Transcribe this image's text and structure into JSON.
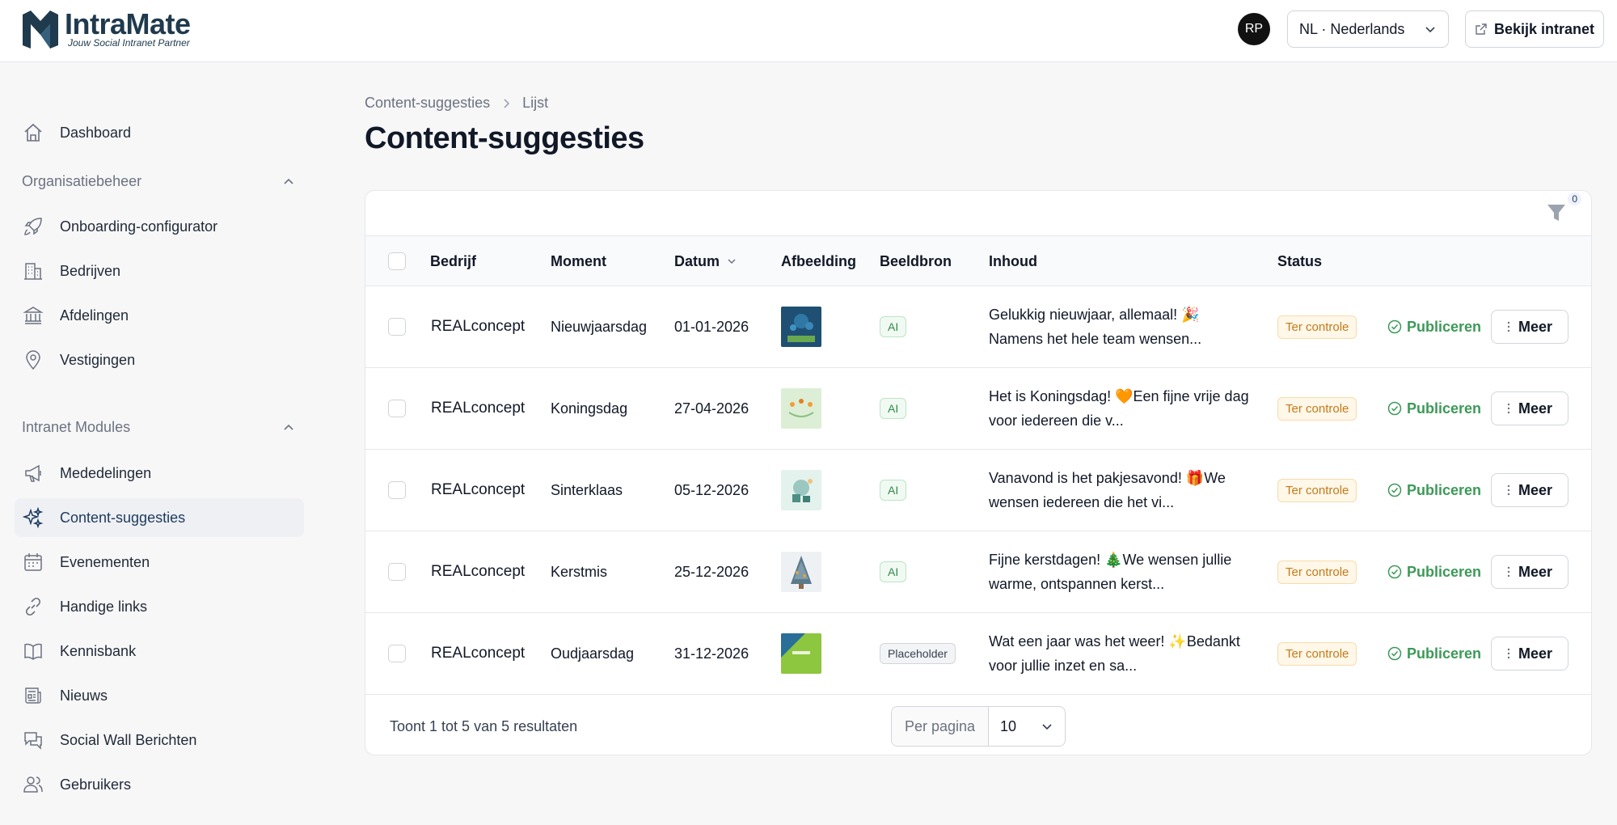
{
  "header": {
    "brand_name": "IntraMate",
    "brand_tagline": "Jouw Social Intranet Partner",
    "avatar_initials": "RP",
    "language": "NL · Nederlands",
    "view_intranet": "Bekijk intranet"
  },
  "sidebar": {
    "dashboard": "Dashboard",
    "group_org": "Organisatiebeheer",
    "org_items": [
      "Onboarding-configurator",
      "Bedrijven",
      "Afdelingen",
      "Vestigingen"
    ],
    "group_modules": "Intranet Modules",
    "module_items": [
      "Mededelingen",
      "Content-suggesties",
      "Evenementen",
      "Handige links",
      "Kennisbank",
      "Nieuws",
      "Social Wall Berichten",
      "Gebruikers"
    ],
    "active_item": "Content-suggesties"
  },
  "breadcrumb": {
    "parent": "Content-suggesties",
    "current": "Lijst"
  },
  "page": {
    "title": "Content-suggesties"
  },
  "filter": {
    "count": "0"
  },
  "table": {
    "columns": {
      "company": "Bedrijf",
      "moment": "Moment",
      "date": "Datum",
      "image": "Afbeelding",
      "source": "Beeldbron",
      "content": "Inhoud",
      "status": "Status"
    },
    "rows": [
      {
        "company": "REALconcept",
        "moment": "Nieuwjaarsdag",
        "date": "01-01-2026",
        "source": "AI",
        "content": "Gelukkig nieuwjaar, allemaal! 🎉 Namens het hele team wensen...",
        "status": "Ter controle",
        "publish": "Publiceren",
        "more": "Meer"
      },
      {
        "company": "REALconcept",
        "moment": "Koningsdag",
        "date": "27-04-2026",
        "source": "AI",
        "content": "Het is Koningsdag! 🧡Een fijne vrije dag voor iedereen die v...",
        "status": "Ter controle",
        "publish": "Publiceren",
        "more": "Meer"
      },
      {
        "company": "REALconcept",
        "moment": "Sinterklaas",
        "date": "05-12-2026",
        "source": "AI",
        "content": "Vanavond is het pakjesavond! 🎁We wensen iedereen die het vi...",
        "status": "Ter controle",
        "publish": "Publiceren",
        "more": "Meer"
      },
      {
        "company": "REALconcept",
        "moment": "Kerstmis",
        "date": "25-12-2026",
        "source": "AI",
        "content": "Fijne kerstdagen! 🎄We wensen jullie warme, ontspannen kerst...",
        "status": "Ter controle",
        "publish": "Publiceren",
        "more": "Meer"
      },
      {
        "company": "REALconcept",
        "moment": "Oudjaarsdag",
        "date": "31-12-2026",
        "source": "Placeholder",
        "content": "Wat een jaar was het weer! ✨Bedankt voor jullie inzet en sa...",
        "status": "Ter controle",
        "publish": "Publiceren",
        "more": "Meer"
      }
    ]
  },
  "footer": {
    "results": "Toont 1 tot 5 van 5 resultaten",
    "per_page_label": "Per pagina",
    "per_page_value": "10"
  },
  "colors": {
    "accent": "#1e3a5f",
    "publish_green": "#3c9a57",
    "status_orange": "#c57a1a"
  }
}
